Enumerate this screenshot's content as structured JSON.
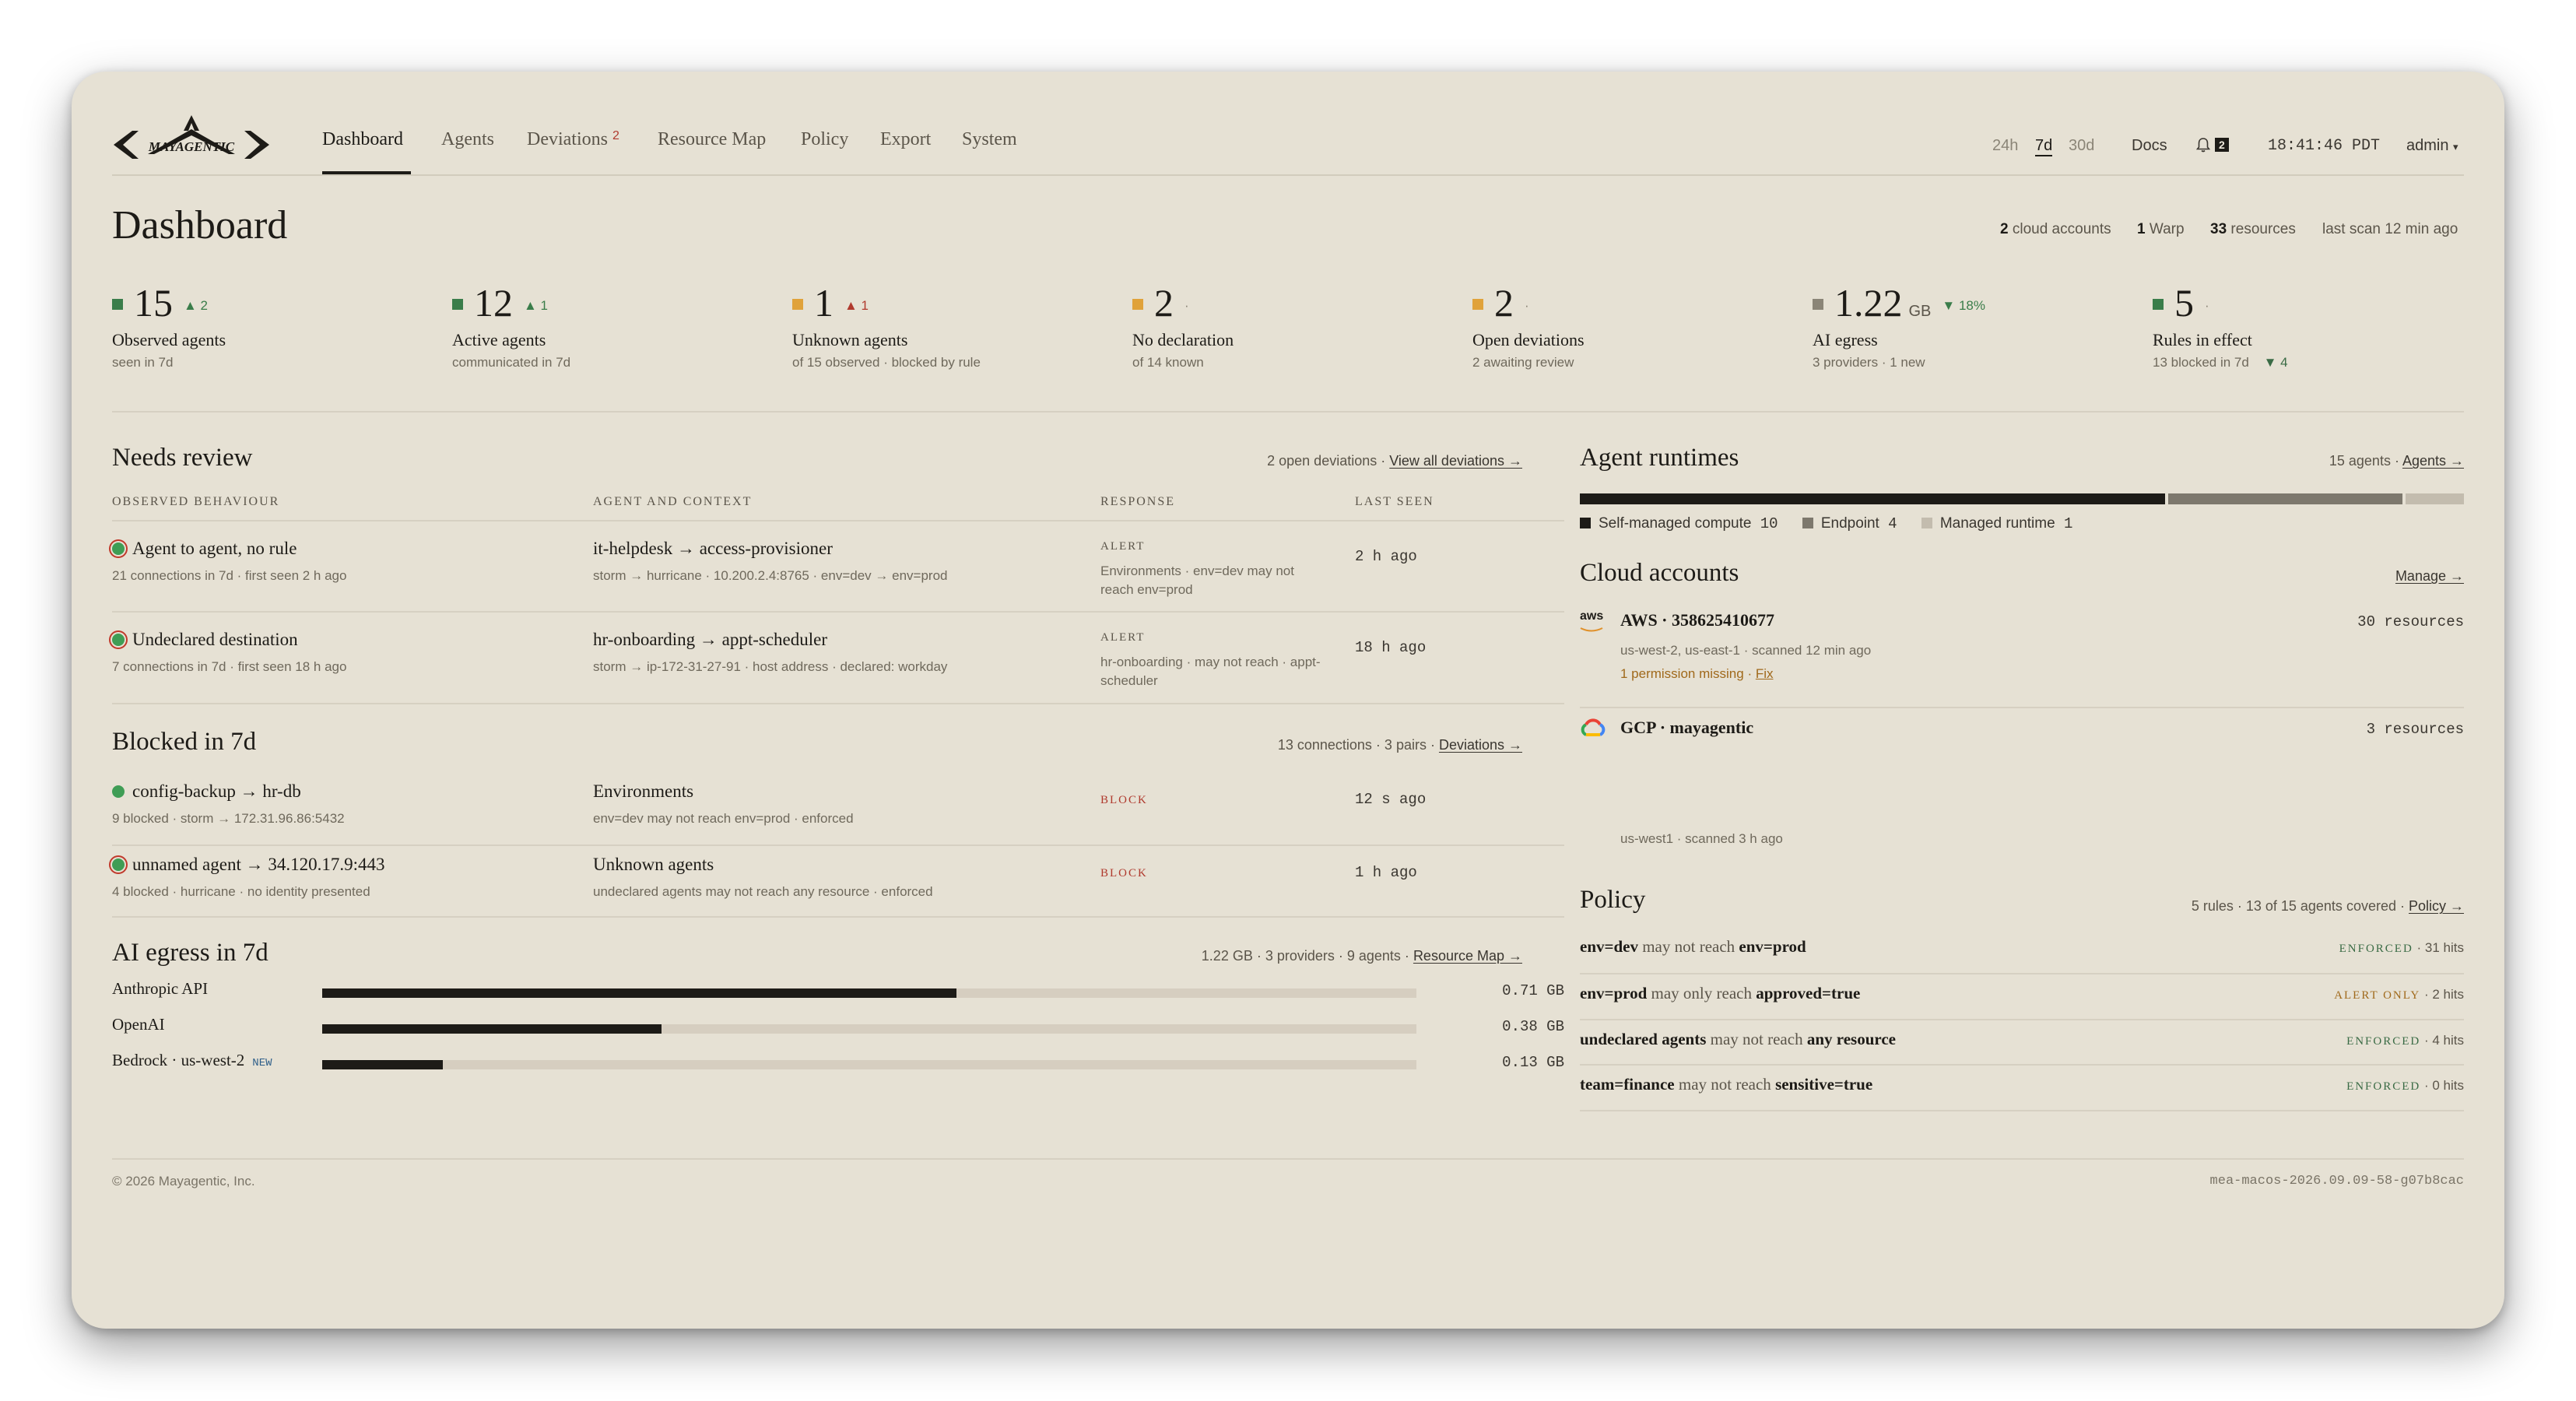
{
  "brand": {
    "name": "MAYAGENTIC"
  },
  "nav": {
    "items": [
      {
        "label": "Dashboard",
        "badge": ""
      },
      {
        "label": "Agents",
        "badge": ""
      },
      {
        "label": "Deviations",
        "badge": "2"
      },
      {
        "label": "Resource Map",
        "badge": ""
      },
      {
        "label": "Policy",
        "badge": ""
      },
      {
        "label": "Export",
        "badge": ""
      },
      {
        "label": "System",
        "badge": ""
      }
    ],
    "active": "Dashboard",
    "ranges": [
      "24h",
      "7d",
      "30d"
    ],
    "selected_range": "7d",
    "docs": "Docs",
    "notifications": "2",
    "clock": "18:41:46 PDT",
    "user": "admin",
    "user_caret": "▾"
  },
  "header": {
    "title": "Dashboard",
    "meta": [
      {
        "num": "2",
        "text": " cloud accounts"
      },
      {
        "num": "1",
        "text": " Warp"
      },
      {
        "num": "33",
        "text": " resources"
      },
      {
        "num": "",
        "text": "last scan 12 min ago"
      }
    ]
  },
  "stats": [
    {
      "value": "15",
      "unit": "",
      "delta": "▲ 2",
      "delta_color": "#3a7d4a",
      "color": "#3a7d4a",
      "label": "Observed agents",
      "sub": "seen in 7d",
      "sub_delta": ""
    },
    {
      "value": "12",
      "unit": "",
      "delta": "▲ 1",
      "delta_color": "#3a7d4a",
      "color": "#3a7d4a",
      "label": "Active agents",
      "sub": "communicated in 7d",
      "sub_delta": ""
    },
    {
      "value": "1",
      "unit": "",
      "delta": "▲ 1",
      "delta_color": "#b03a2e",
      "color": "#e0a23a",
      "label": "Unknown agents",
      "sub": "of 15 observed · blocked by rule",
      "sub_delta": ""
    },
    {
      "value": "2",
      "unit": "",
      "delta": "·",
      "delta_color": "#8b8577",
      "color": "#e0a23a",
      "label": "No declaration",
      "sub": "of 14 known",
      "sub_delta": ""
    },
    {
      "value": "2",
      "unit": "",
      "delta": "·",
      "delta_color": "#8b8577",
      "color": "#e0a23a",
      "label": "Open deviations",
      "sub": "2 awaiting review",
      "sub_delta": ""
    },
    {
      "value": "1.22",
      "unit": "GB",
      "delta": "▼ 18%",
      "delta_color": "#3a7d4a",
      "color": "#8b8577",
      "label": "AI egress",
      "sub": "3 providers · 1 new",
      "sub_delta": ""
    },
    {
      "value": "5",
      "unit": "",
      "delta": "·",
      "delta_color": "#8b8577",
      "color": "#3a7d4a",
      "label": "Rules in effect",
      "sub": "13 blocked in 7d",
      "sub_delta": "▼ 4"
    }
  ],
  "needs_review": {
    "title": "Needs review",
    "meta": "2 open deviations · ",
    "link": "View all deviations →",
    "columns": [
      "OBSERVED BEHAVIOUR",
      "AGENT AND CONTEXT",
      "RESPONSE",
      "LAST SEEN"
    ],
    "rows": [
      {
        "title": "Agent to agent, no rule",
        "sub": "21 connections in 7d · first seen 2 h ago",
        "agent": "it-helpdesk → access-provisioner",
        "context": "storm → hurricane · 10.200.2.4:8765 · env=dev → env=prod",
        "response": "ALERT",
        "response_note_1": "Environments · env=dev may not",
        "response_note_2": "reach env=prod",
        "last_seen": "2 h ago"
      },
      {
        "title": "Undeclared destination",
        "sub": "7 connections in 7d · first seen 18 h ago",
        "agent": "hr-onboarding → appt-scheduler",
        "context": "storm → ip-172-31-27-91 · host address · declared: workday",
        "response": "ALERT",
        "response_note_1": "hr-onboarding · may not reach · appt-",
        "response_note_2": "scheduler",
        "last_seen": "18 h ago"
      }
    ]
  },
  "blocked": {
    "title": "Blocked in 7d",
    "meta": "13 connections · 3 pairs · ",
    "link": "Deviations →",
    "rows": [
      {
        "title": "config-backup → hr-db",
        "sub": "9 blocked · storm → 172.31.96.86:5432",
        "rule": "Environments",
        "rule_sub": "env=dev may not reach env=prod · enforced",
        "response": "BLOCK",
        "last_seen": "12 s ago",
        "ring": false
      },
      {
        "title": "unnamed agent → 34.120.17.9:443",
        "sub": "4 blocked · hurricane · no identity presented",
        "rule": "Unknown agents",
        "rule_sub": "undeclared agents may not reach any resource · enforced",
        "response": "BLOCK",
        "last_seen": "1 h ago",
        "ring": true
      }
    ]
  },
  "egress": {
    "title": "AI egress in 7d",
    "meta": "1.22 GB · 3 providers · 9 agents · ",
    "link": "Resource Map →",
    "rows": [
      {
        "label": "Anthropic API",
        "tag": "",
        "value": "0.71 GB",
        "fraction": 0.58
      },
      {
        "label": "OpenAI",
        "tag": "",
        "value": "0.38 GB",
        "fraction": 0.31
      },
      {
        "label": "Bedrock · us-west-2",
        "tag": "NEW",
        "value": "0.13 GB",
        "fraction": 0.11
      }
    ]
  },
  "runtimes": {
    "title": "Agent runtimes",
    "meta": "15 agents · ",
    "link": "Agents →",
    "segments": [
      {
        "label": "Self-managed compute",
        "count": "10",
        "value": 10,
        "color": "#1d1b17"
      },
      {
        "label": "Endpoint",
        "count": "4",
        "value": 4,
        "color": "#7d786d"
      },
      {
        "label": "Managed runtime",
        "count": "1",
        "value": 1,
        "color": "#c3bcae"
      }
    ]
  },
  "cloud": {
    "title": "Cloud accounts",
    "link": "Manage →",
    "accounts": [
      {
        "icon": "aws-icon",
        "icon_text": "aws",
        "title": "AWS · 358625410677",
        "resources": "30 resources",
        "sub": "us-west-2, us-east-1 · scanned 12 min ago",
        "warn": "1 permission missing · ",
        "warn_link": "Fix"
      },
      {
        "icon": "gcp-icon",
        "icon_text": "",
        "title": "GCP · mayagentic",
        "resources": "3 resources",
        "sub": "us-west1 · scanned 3 h ago",
        "warn": "",
        "warn_link": ""
      }
    ]
  },
  "policy": {
    "title": "Policy",
    "meta": "5 rules · 13 of 15 agents covered · ",
    "link": "Policy →",
    "rules": [
      {
        "subject": "env=dev",
        "verb": " may not reach ",
        "object": "env=prod",
        "status": "ENFORCED",
        "status_color": "#3a6b45",
        "hits": " · 31 hits"
      },
      {
        "subject": "env=prod",
        "verb": " may only reach ",
        "object": "approved=true",
        "status": "ALERT ONLY",
        "status_color": "#a0691b",
        "hits": " · 2 hits"
      },
      {
        "subject": "undeclared agents",
        "verb": " may not reach ",
        "object": "any resource",
        "status": "ENFORCED",
        "status_color": "#3a6b45",
        "hits": " · 4 hits"
      },
      {
        "subject": "team=finance",
        "verb": " may not reach ",
        "object": "sensitive=true",
        "status": "ENFORCED",
        "status_color": "#3a6b45",
        "hits": " · 0 hits"
      }
    ]
  },
  "footer": {
    "copyright": "© 2026 Mayagentic, Inc.",
    "build": "mea-macos-2026.09.09-58-g07b8cac"
  }
}
